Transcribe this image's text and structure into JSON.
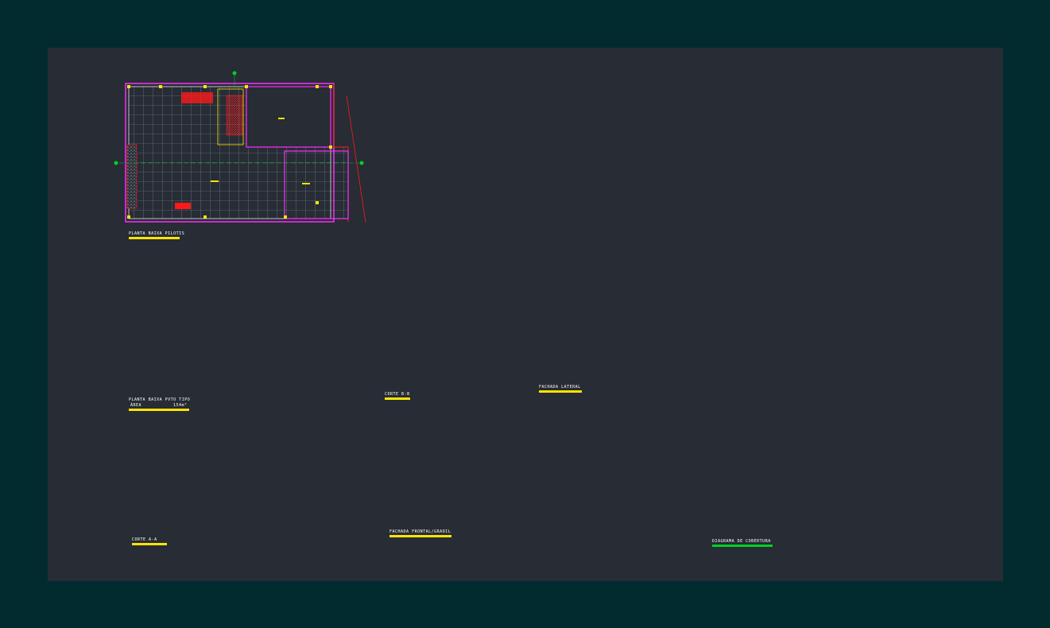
{
  "drawing": {
    "background_colors": {
      "outer": "#022b30",
      "model_space": "#272c35"
    },
    "layer_colors": {
      "red": "#ff1a1a",
      "magenta": "#ff2cff",
      "yellow": "#ffe400",
      "white": "#ffffff",
      "cyan": "#00e5ff",
      "green": "#00d028",
      "grid": "#8a9fb0"
    },
    "labels": {
      "planta_pilotis": "PLANTA BAIXA PILOTIS",
      "planta_tipo": "PLANTA BAIXA PVTO TIPO",
      "area_label": "ÁREA",
      "area_value": "154m²",
      "corte_bb": "CORTE B-B",
      "fachada_lateral": "FACHADA LATERAL",
      "corte_aa": "CORTE A-A",
      "fachada_frontal": "FACHADA FRONTAL/GRADIL",
      "diagrama_cobertura": "DIAGRAMA DE COBERTURA"
    }
  }
}
